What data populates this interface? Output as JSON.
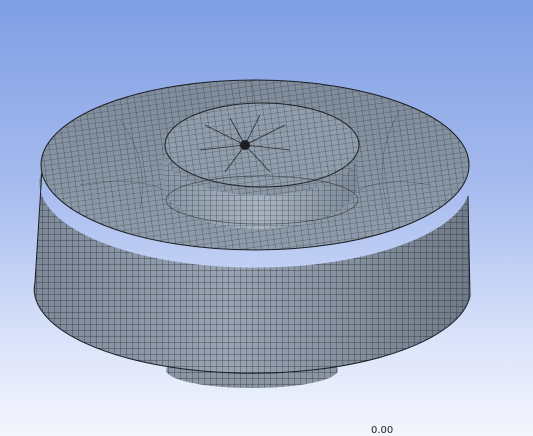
{
  "viewport": {
    "background_top": "#7f9ee4",
    "background_bottom": "#f4f6fd",
    "model": {
      "name": "meshed-axisymmetric-part",
      "element_shape": "quad",
      "fill_color": "#8c9aaa",
      "mesh_line_color": "#1c1f24"
    },
    "scale_readout": "0.00"
  }
}
